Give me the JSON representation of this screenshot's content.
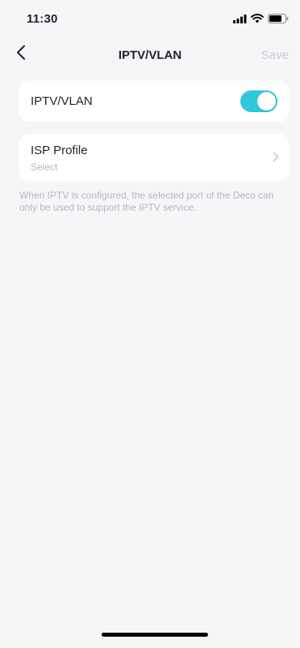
{
  "status_bar": {
    "time": "11:30",
    "icons": [
      "signal-icon",
      "wifi-icon",
      "battery-icon"
    ]
  },
  "nav": {
    "back_icon": "chevron-left-icon",
    "title": "IPTV/VLAN",
    "save_label": "Save"
  },
  "iptv_card": {
    "label": "IPTV/VLAN",
    "toggle_on": true
  },
  "isp_card": {
    "title": "ISP Profile",
    "value": "Select",
    "icon": "chevron-right-icon"
  },
  "note": "When IPTV is configured, the selected port of the Deco can only be used to support the IPTV service.",
  "colors": {
    "background": "#f5f6f8",
    "accent": "#2ec8dc",
    "muted_text": "#b3b7bd",
    "disabled_save": "#c9ccd1"
  }
}
